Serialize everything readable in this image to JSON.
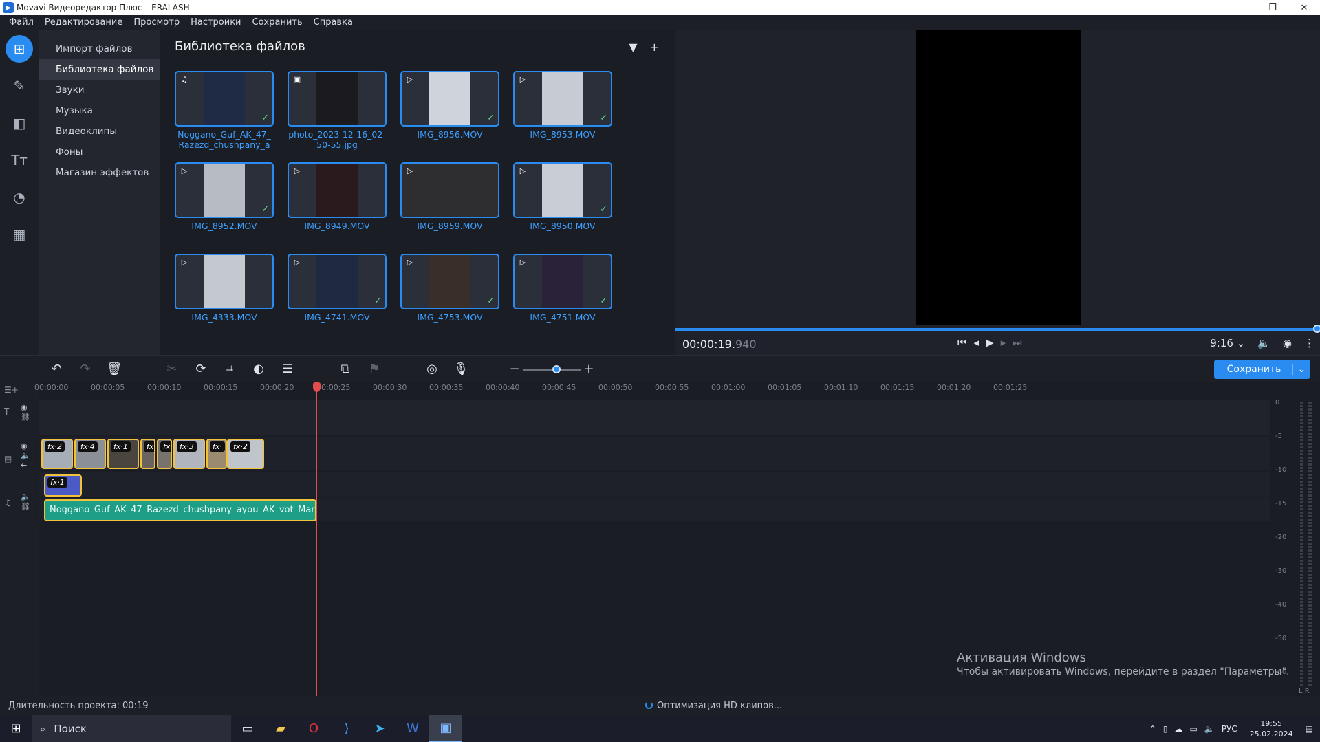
{
  "window": {
    "title": "Movavi Видеоредактор Плюс – ERALASH",
    "minimize": "—",
    "maximize": "❐",
    "close": "✕"
  },
  "menu": [
    "Файл",
    "Редактирование",
    "Просмотр",
    "Настройки",
    "Сохранить",
    "Справка"
  ],
  "rail": {
    "icons": [
      "import-icon",
      "magic-wand-icon",
      "transitions-icon",
      "titles-icon",
      "filters-icon",
      "more-tools-icon"
    ]
  },
  "categories": [
    "Импорт файлов",
    "Библиотека файлов",
    "Звуки",
    "Музыка",
    "Видеоклипы",
    "Фоны",
    "Магазин эффектов"
  ],
  "library": {
    "title": "Библиотека файлов",
    "items": [
      {
        "name": "Noggano_Guf_AK_47_Razezd_chushpany_a",
        "type": "audio",
        "checked": true
      },
      {
        "name": "photo_2023-12-16_02-50-55.jpg",
        "type": "image",
        "checked": false
      },
      {
        "name": "IMG_8956.MOV",
        "type": "video",
        "checked": true
      },
      {
        "name": "IMG_8953.MOV",
        "type": "video",
        "checked": true
      },
      {
        "name": "IMG_8952.MOV",
        "type": "video",
        "checked": true
      },
      {
        "name": "IMG_8949.MOV",
        "type": "video",
        "checked": false
      },
      {
        "name": "IMG_8959.MOV",
        "type": "video",
        "checked": false
      },
      {
        "name": "IMG_8950.MOV",
        "type": "video",
        "checked": true
      },
      {
        "name": "IMG_4333.MOV",
        "type": "video",
        "checked": false
      },
      {
        "name": "IMG_4741.MOV",
        "type": "video",
        "checked": true
      },
      {
        "name": "IMG_4753.MOV",
        "type": "video",
        "checked": true
      },
      {
        "name": "IMG_4751.MOV",
        "type": "video",
        "checked": true
      }
    ]
  },
  "preview": {
    "timecode": "00:00:19.",
    "timecode_ms": "940",
    "aspect": "9:16 ⌄"
  },
  "toolbar": {
    "export_label": "Сохранить"
  },
  "timeline": {
    "ruler": [
      "00:00:00",
      "00:00:05",
      "00:00:10",
      "00:00:15",
      "00:00:20",
      "00:00:25",
      "00:00:30",
      "00:00:35",
      "00:00:40",
      "00:00:45",
      "00:00:50",
      "00:00:55",
      "00:01:00",
      "00:01:05",
      "00:01:10",
      "00:01:15",
      "00:01:20",
      "00:01:25"
    ],
    "video_clips": [
      "fx·2",
      "fx·4",
      "fx·1",
      "fx",
      "fx",
      "fx·3",
      "fx·",
      "fx·2"
    ],
    "overlay_clip": "fx·1",
    "audio_clip": "Noggano_Guf_AK_47_Razezd_chushpany_ayou_AK_vot_Man",
    "vu_scale": [
      "0",
      "-5",
      "-10",
      "-15",
      "-20",
      "-30",
      "-40",
      "-50",
      "-60"
    ],
    "vu_lr": "L R"
  },
  "activation": {
    "title": "Активация Windows",
    "subtitle": "Чтобы активировать Windows, перейдите в раздел \"Параметры\"."
  },
  "status": {
    "duration": "Длительность проекта: 00:19",
    "optimizing": "Оптимизация HD клипов..."
  },
  "taskbar": {
    "search_placeholder": "Поиск",
    "lang": "РУС",
    "time": "19:55",
    "date": "25.02.2024"
  },
  "colors": {
    "accent": "#2a8cf0",
    "clip_border": "#f0c33a",
    "audio_clip": "#1e9e87",
    "playhead": "#e34c4c",
    "check": "#5fd38d"
  }
}
